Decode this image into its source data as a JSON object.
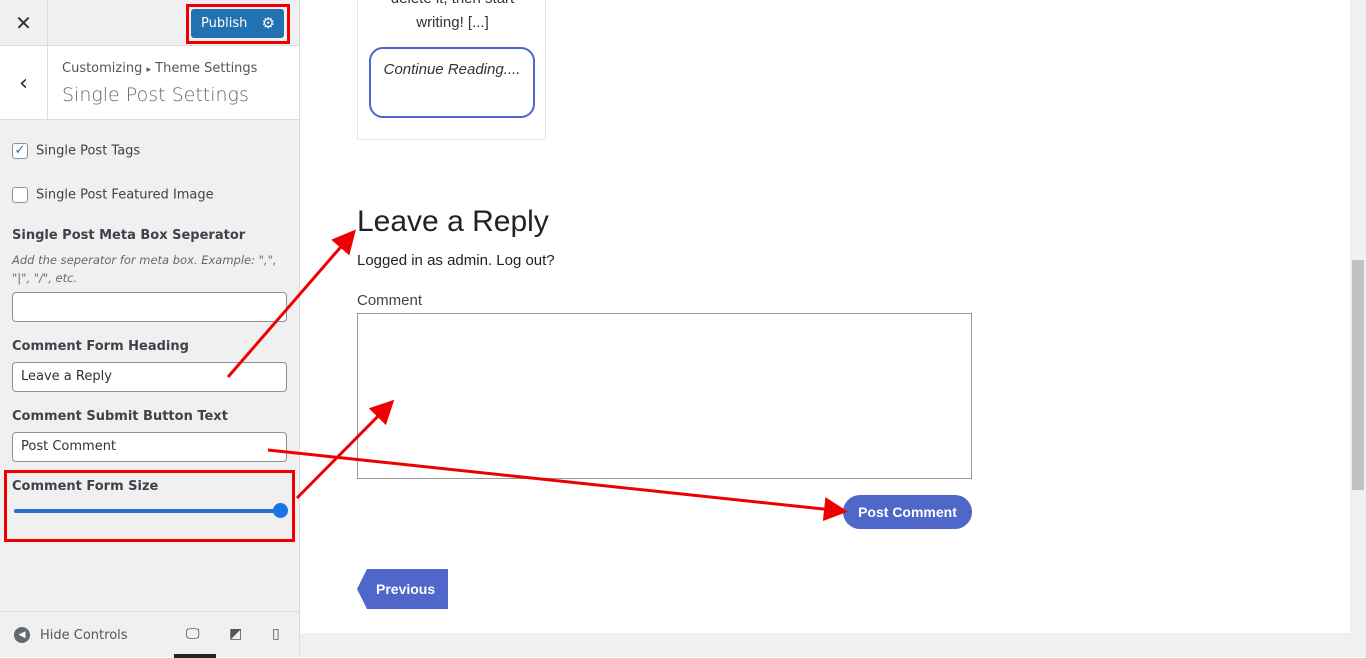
{
  "sidebar": {
    "close_icon": "close-icon",
    "publish_label": "Publish",
    "breadcrumb": {
      "root": "Customizing",
      "sep": "▸",
      "parent": "Theme Settings"
    },
    "title": "Single Post Settings",
    "single_post_tags": {
      "label": "Single Post Tags",
      "checked": true
    },
    "single_post_featured_image": {
      "label": "Single Post Featured Image",
      "checked": false
    },
    "meta_separator": {
      "label": "Single Post Meta Box Seperator",
      "description": "Add the seperator for meta box. Example: \",\", \"|\", \"/\", etc.",
      "value": ""
    },
    "comment_heading": {
      "label": "Comment Form Heading",
      "value": "Leave a Reply"
    },
    "comment_button": {
      "label": "Comment Submit Button Text",
      "value": "Post Comment"
    },
    "comment_size": {
      "label": "Comment Form Size",
      "value_percent": 100
    },
    "hide_controls": "Hide Controls"
  },
  "preview": {
    "excerpt_line1": "delete it, then start",
    "excerpt_line2": "writing! [...]",
    "continue_reading": "Continue Reading....",
    "reply_heading": "Leave a Reply",
    "logged_in": "Logged in as admin. Log out?",
    "comment_label": "Comment",
    "post_comment": "Post Comment",
    "previous": "Previous"
  },
  "colors": {
    "accent": "#4f67c9",
    "publish": "#2271b1",
    "annotation": "#ee0000"
  }
}
